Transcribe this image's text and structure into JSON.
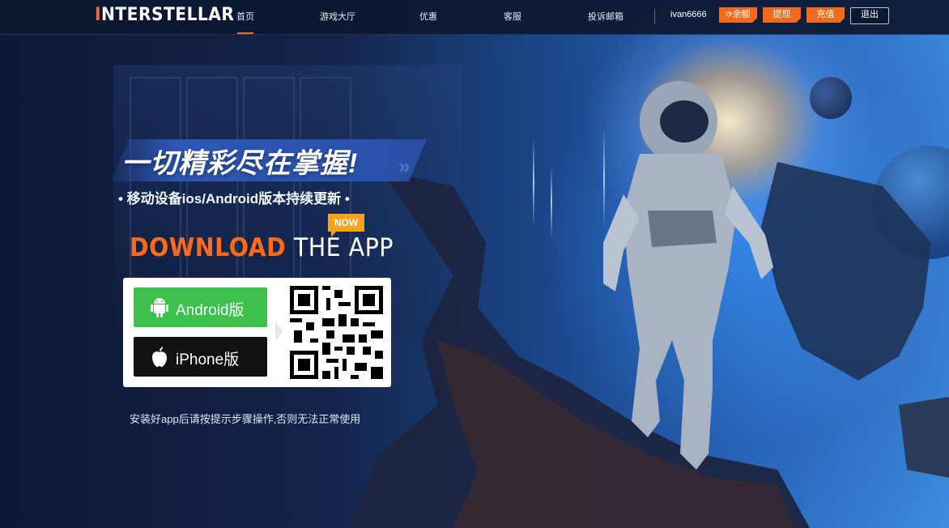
{
  "header": {
    "logo_first": "I",
    "logo_rest": "NTERSTELLAR",
    "nav": [
      {
        "label": "首页",
        "active": true
      },
      {
        "label": "游戏大厅"
      },
      {
        "label": "优惠"
      },
      {
        "label": "客服"
      },
      {
        "label": "投诉邮箱"
      }
    ],
    "username": "ivan6666",
    "balance_label": "余额",
    "withdraw_label": "提现",
    "deposit_label": "充值",
    "logout_label": "退出"
  },
  "promo": {
    "slogan": "一切精彩尽在掌握!",
    "subtitle": "• 移动设备ios/Android版本持续更新 •",
    "badge": "NOW",
    "download_highlight": "DOWNLOAD",
    "download_rest": " THE APP",
    "android_label": "Android版",
    "iphone_label": "iPhone版",
    "note": "安装好app后请按提示步骤操作,否则无法正常使用"
  },
  "colors": {
    "accent": "#ff6a1a",
    "android_green": "#3cc14e",
    "iphone_black": "#111111",
    "badge": "#f4a31b",
    "header_bg": "#0c1830"
  },
  "icons": [
    "android-icon",
    "apple-icon",
    "refresh-icon",
    "qr-code"
  ]
}
